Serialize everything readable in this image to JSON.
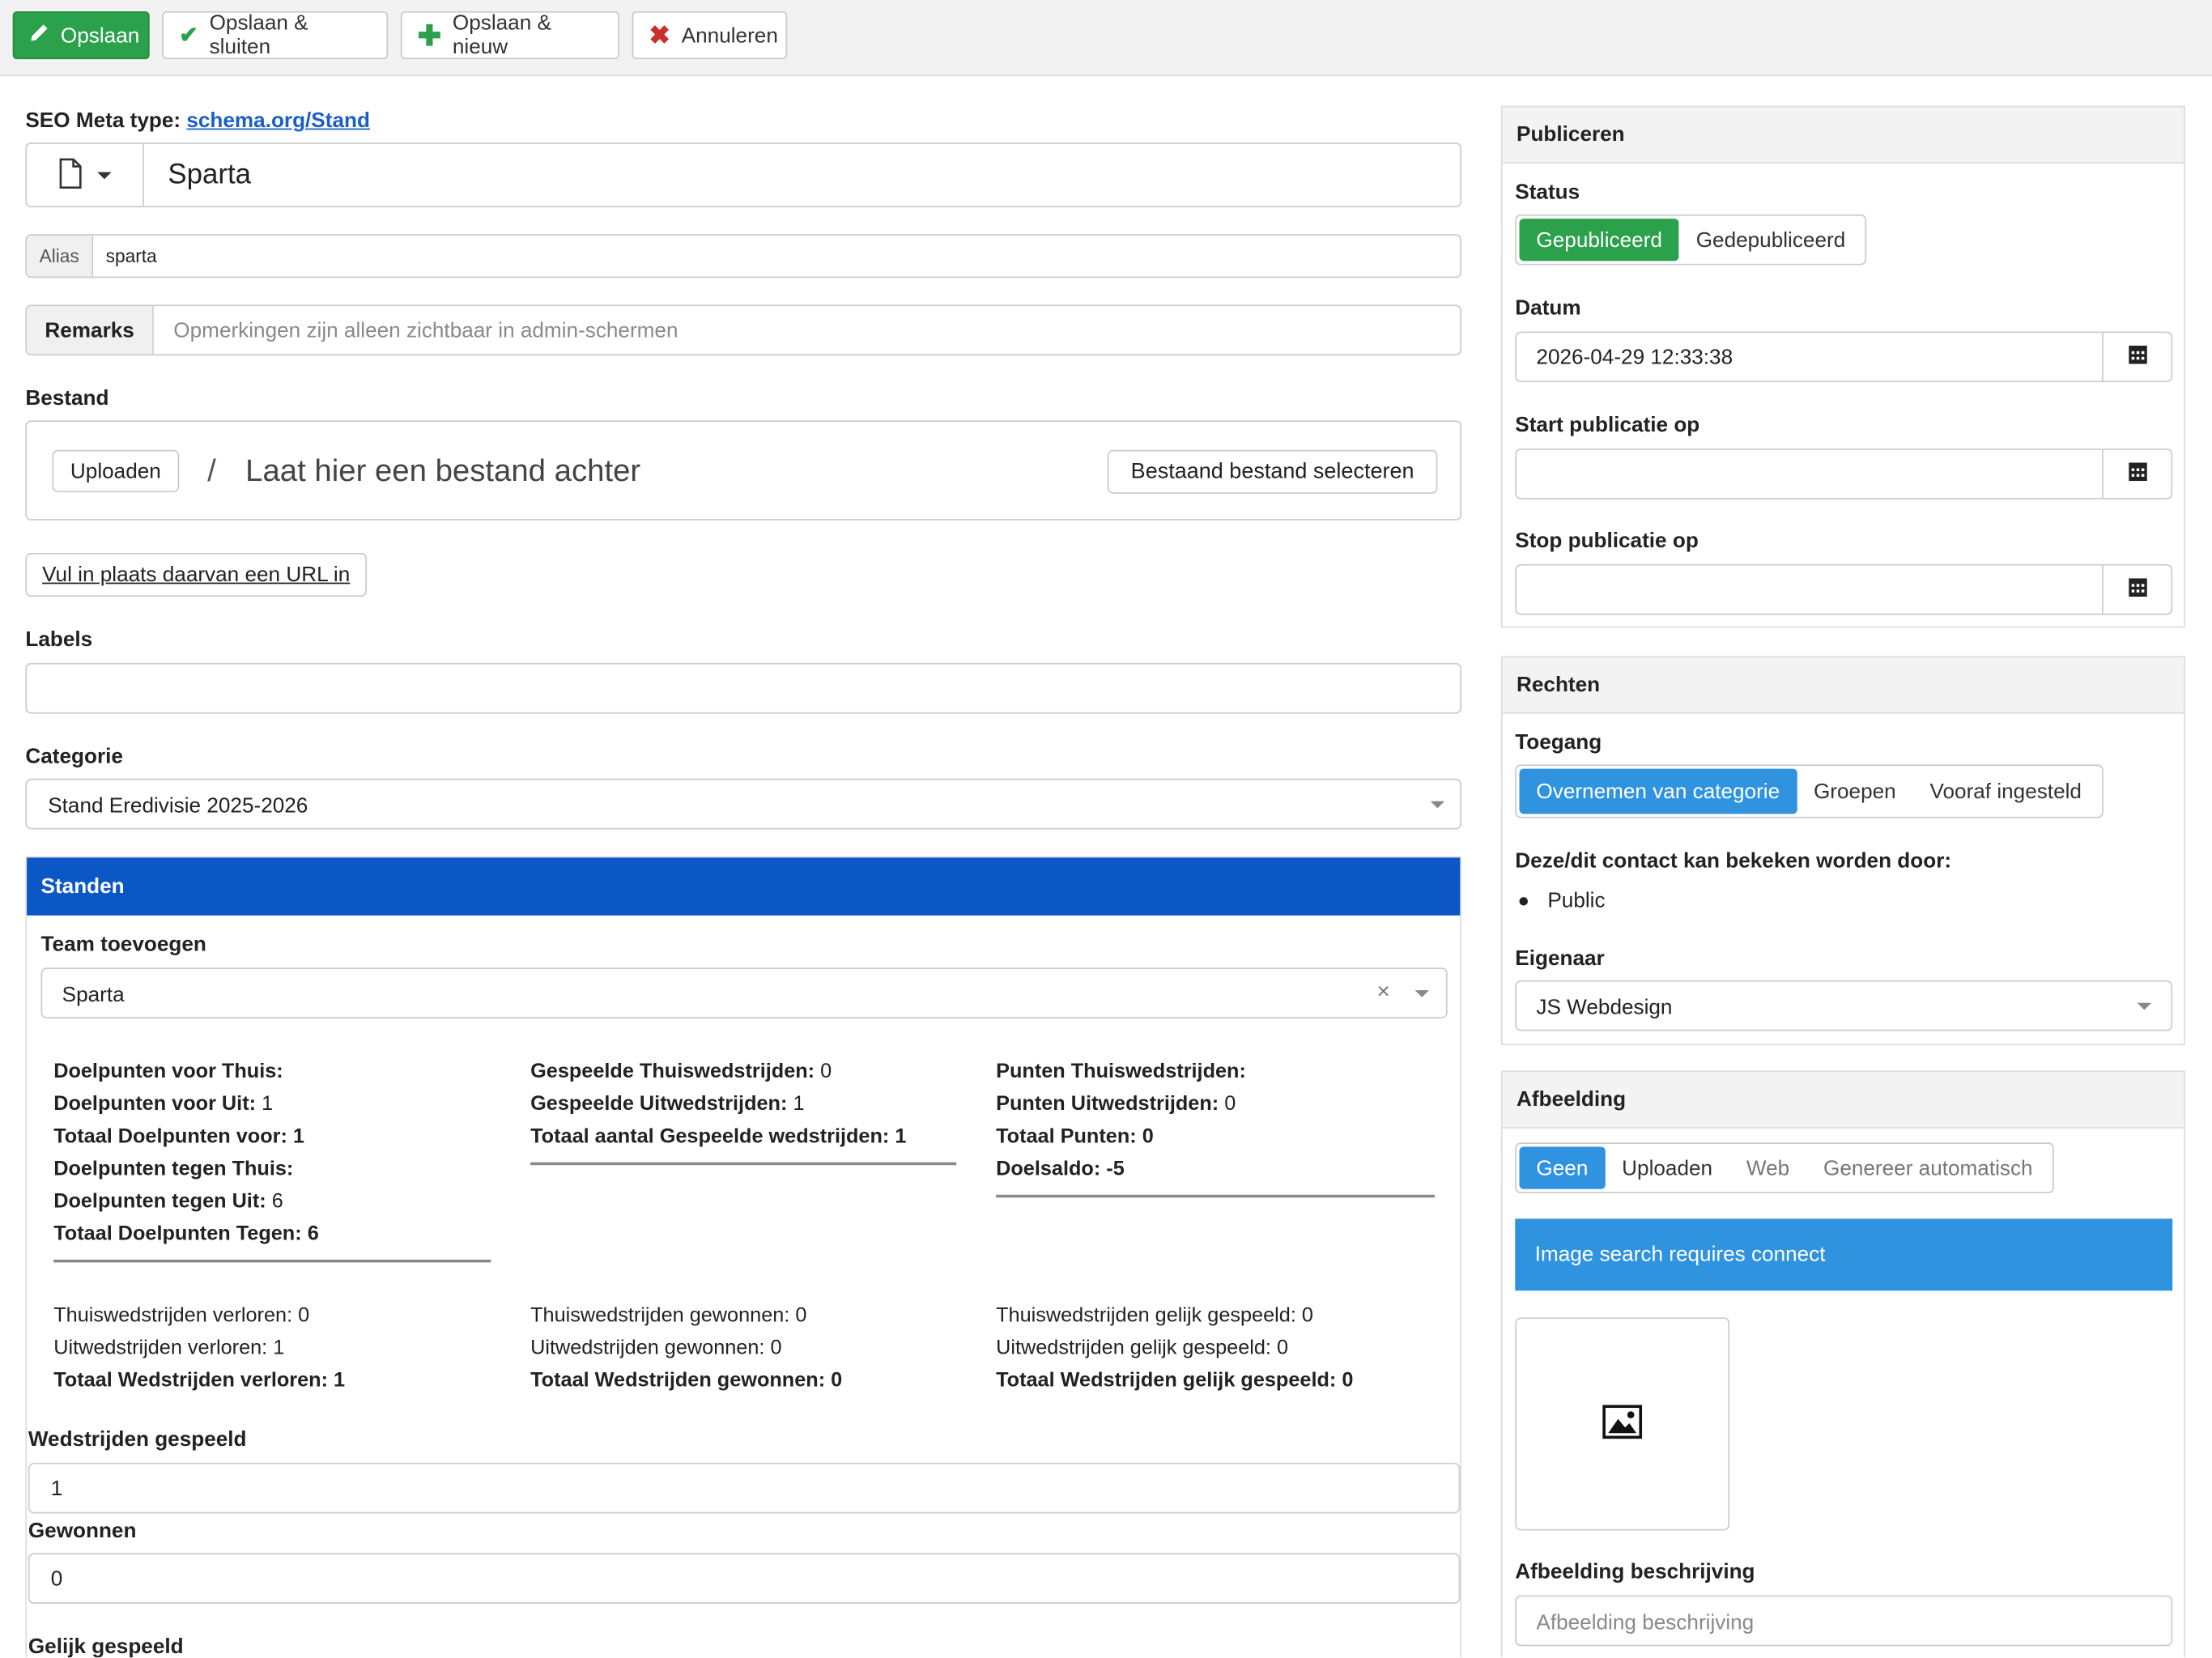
{
  "toolbar": {
    "save": "Opslaan",
    "save_close": "Opslaan & sluiten",
    "save_new": "Opslaan & nieuw",
    "cancel": "Annuleren"
  },
  "seo": {
    "label": "SEO Meta type:",
    "link": "schema.org/Stand"
  },
  "title_value": "Sparta",
  "alias": {
    "label": "Alias",
    "value": "sparta"
  },
  "remarks": {
    "label": "Remarks",
    "placeholder": "Opmerkingen zijn alleen zichtbaar in admin-schermen"
  },
  "file": {
    "label": "Bestand",
    "upload": "Uploaden",
    "slash": "/",
    "drop": "Laat hier een bestand achter",
    "select_existing": "Bestaand bestand selecteren",
    "url_button": "Vul in plaats daarvan een URL in"
  },
  "labels_label": "Labels",
  "category": {
    "label": "Categorie",
    "value": "Stand Eredivisie 2025-2026"
  },
  "standen": {
    "header": "Standen",
    "team_label": "Team toevoegen",
    "team_value": "Sparta",
    "clear": "×",
    "col1": [
      {
        "k": "Doelpunten voor Thuis:",
        "v": ""
      },
      {
        "k": "Doelpunten voor Uit:",
        "v": "1"
      },
      {
        "k": "Totaal Doelpunten voor:",
        "v": "1",
        "bold": true
      },
      {
        "k": "Doelpunten tegen Thuis:",
        "v": ""
      },
      {
        "k": "Doelpunten tegen Uit:",
        "v": "6"
      },
      {
        "k": "Totaal Doelpunten Tegen:",
        "v": "6",
        "bold": true
      }
    ],
    "col2": [
      {
        "k": "Gespeelde Thuiswedstrijden:",
        "v": "0"
      },
      {
        "k": "Gespeelde Uitwedstrijden:",
        "v": "1"
      },
      {
        "k": "Totaal aantal Gespeelde wedstrijden:",
        "v": "1",
        "bold": true
      }
    ],
    "col3": [
      {
        "k": "Punten Thuiswedstrijden:",
        "v": ""
      },
      {
        "k": "Punten Uitwedstrijden:",
        "v": "0"
      },
      {
        "k": "Totaal Punten:",
        "v": "0",
        "bold": true
      },
      {
        "k": "Doelsaldo:",
        "v": "-5",
        "bold": true
      }
    ],
    "res1": [
      "Thuiswedstrijden verloren: 0",
      "Uitwedstrijden verloren: 1",
      "Totaal Wedstrijden verloren: 1"
    ],
    "res2": [
      "Thuiswedstrijden gewonnen: 0",
      "Uitwedstrijden gewonnen: 0",
      "Totaal Wedstrijden gewonnen: 0"
    ],
    "res3": [
      "Thuiswedstrijden gelijk gespeeld: 0",
      "Uitwedstrijden gelijk gespeeld: 0",
      "Totaal Wedstrijden gelijk gespeeld: 0"
    ]
  },
  "fields": {
    "played_label": "Wedstrijden gespeeld",
    "played_value": "1",
    "won_label": "Gewonnen",
    "won_value": "0",
    "draw_label": "Gelijk gespeeld"
  },
  "publish": {
    "header": "Publiceren",
    "status_label": "Status",
    "status_on": "Gepubliceerd",
    "status_off": "Gedepubliceerd",
    "date_label": "Datum",
    "date_value": "2026-04-29 12:33:38",
    "start_label": "Start publicatie op",
    "stop_label": "Stop publicatie op"
  },
  "rights": {
    "header": "Rechten",
    "access_label": "Toegang",
    "access_opts": [
      "Overnemen van categorie",
      "Groepen",
      "Vooraf ingesteld"
    ],
    "viewers_label": "Deze/dit contact kan bekeken worden door:",
    "viewer": "Public",
    "owner_label": "Eigenaar",
    "owner_value": "JS Webdesign"
  },
  "image": {
    "header": "Afbeelding",
    "opts": [
      "Geen",
      "Uploaden",
      "Web",
      "Genereer automatisch"
    ],
    "banner": "Image search requires connect",
    "desc_label": "Afbeelding beschrijving",
    "desc_placeholder": "Afbeelding beschrijving"
  },
  "colors": {
    "green": "#2aa14a",
    "blue_header": "#0c57c6",
    "blue_btn": "#2f93e0",
    "red": "#c9302c"
  },
  "icons": [
    "pencil-icon",
    "check-icon",
    "plus-icon",
    "x-icon",
    "document-icon",
    "calendar-icon",
    "image-icon",
    "chevron-down-icon",
    "clear-icon"
  ]
}
